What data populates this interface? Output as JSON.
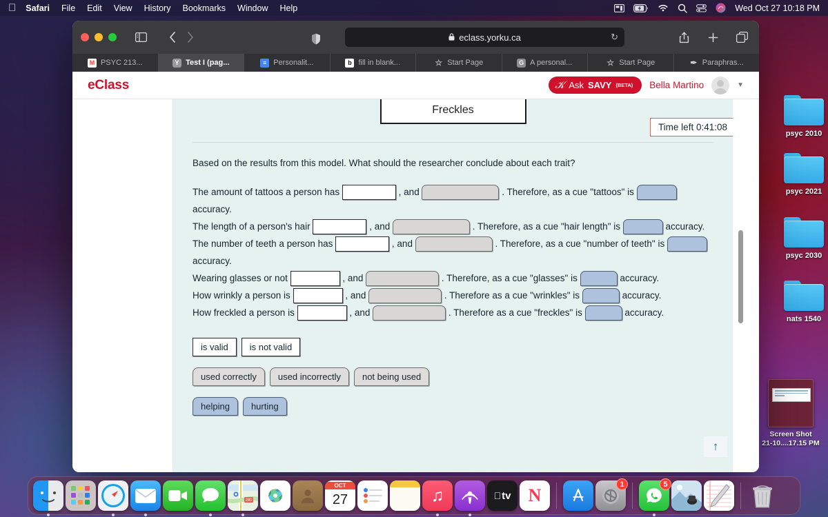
{
  "menubar": {
    "apple_icon": "apple-icon",
    "items": [
      {
        "label": "Safari",
        "bold": true
      },
      {
        "label": "File",
        "bold": false
      },
      {
        "label": "Edit",
        "bold": false
      },
      {
        "label": "View",
        "bold": false
      },
      {
        "label": "History",
        "bold": false
      },
      {
        "label": "Bookmarks",
        "bold": false
      },
      {
        "label": "Window",
        "bold": false
      },
      {
        "label": "Help",
        "bold": false
      }
    ],
    "status_icons": [
      "screen-mirroring-icon",
      "battery-charging-icon",
      "wifi-icon",
      "spotlight-search-icon",
      "control-center-icon",
      "siri-icon"
    ],
    "clock": "Wed Oct 27  10:18 PM"
  },
  "desktop": {
    "folders": [
      {
        "label": "psyc 2010"
      },
      {
        "label": "psyc 2021"
      },
      {
        "label": "psyc 2030"
      },
      {
        "label": "nats 1540"
      }
    ],
    "screenshot_file": {
      "line1": "Screen Shot",
      "line2": "21-10....17.15 PM"
    }
  },
  "safari": {
    "toolbar": {
      "sidebar_icon": "sidebar-toggle-icon",
      "back_icon": "chevron-left-icon",
      "forward_icon": "chevron-right-icon",
      "shield_icon": "privacy-shield-icon",
      "reader_icon": "reader-view-icon",
      "lock_icon": "lock-icon",
      "url": "eclass.yorku.ca",
      "reload_icon": "reload-icon",
      "share_icon": "share-icon",
      "new_tab_icon": "plus-icon",
      "tab_overview_icon": "tab-overview-icon"
    },
    "tabs": [
      {
        "label": "PSYC 213...",
        "favicon": "gmail-icon",
        "favicon_class": "gmail",
        "glyph": "M",
        "active": false
      },
      {
        "label": "Test I (pag...",
        "favicon": "yorku-icon",
        "favicon_class": "yorku",
        "glyph": "Y",
        "active": true
      },
      {
        "label": "Personalit...",
        "favicon": "google-docs-icon",
        "favicon_class": "gdocs",
        "glyph": "≡",
        "active": false
      },
      {
        "label": "fill in blank...",
        "favicon": "blackboard-icon",
        "favicon_class": "bb",
        "glyph": "b",
        "active": false
      },
      {
        "label": "Start Page",
        "favicon": "star-icon",
        "favicon_class": "star",
        "glyph": "☆",
        "active": false
      },
      {
        "label": "A personal...",
        "favicon": "google-icon",
        "favicon_class": "gsite",
        "glyph": "G",
        "active": false
      },
      {
        "label": "Start Page",
        "favicon": "star-icon",
        "favicon_class": "star",
        "glyph": "☆",
        "active": false
      },
      {
        "label": "Paraphras...",
        "favicon": "pen-icon",
        "favicon_class": "para",
        "glyph": "✒",
        "active": false
      }
    ]
  },
  "eclass": {
    "logo": "eClass",
    "savy": {
      "ask": "Ask",
      "name": "SAVY",
      "beta": "(BETA)",
      "mark_icon": "savy-logo-icon"
    },
    "user_name": "Bella Martino",
    "avatar_icon": "user-avatar-icon",
    "caret_icon": "chevron-down-icon",
    "brand_color": "#d0112b"
  },
  "quiz": {
    "diagram_label": "Freckles",
    "timer": "Time left 0:41:08",
    "prompt": "Based on the results from this model. What should the researcher conclude about each trait?",
    "rows": [
      {
        "lead": "The amount of tattoos a person has",
        "blank_white_w": 78,
        "sep": ", and",
        "blank_gray_w": 112,
        "mid": ". Therefore, as a cue \"tattoos\" is",
        "blank_blue_w": 58,
        "tail": "accuracy.",
        "wraps": true
      },
      {
        "lead": "The length of a person's hair",
        "blank_white_w": 78,
        "sep": ", and",
        "blank_gray_w": 112,
        "mid": ". Therefore, as a cue \"hair length\" is",
        "blank_blue_w": 58,
        "tail": "accuracy.",
        "wraps": true
      },
      {
        "lead": "The number of teeth a person has",
        "blank_white_w": 78,
        "sep": ", and",
        "blank_gray_w": 112,
        "mid": ". Therefore, as a cue \"number of teeth\" is",
        "blank_blue_w": 58,
        "tail": "accuracy.",
        "wraps": true
      },
      {
        "lead": "Wearing glasses or not",
        "blank_white_w": 72,
        "sep": ", and",
        "blank_gray_w": 106,
        "mid": ". Therefore, as a cue \"glasses\" is",
        "blank_blue_w": 54,
        "tail": "accuracy.",
        "wraps": false
      },
      {
        "lead": "How wrinkly a person is",
        "blank_white_w": 72,
        "sep": ", and",
        "blank_gray_w": 106,
        "mid": ". Therefore as a cue \"wrinkles\" is",
        "blank_blue_w": 54,
        "tail": "accuracy.",
        "wraps": false
      },
      {
        "lead": "How freckled a person is",
        "blank_white_w": 72,
        "sep": ", and",
        "blank_gray_w": 106,
        "mid": ". Therefore as a cue \"freckles\" is",
        "blank_blue_w": 54,
        "tail": "accuracy.",
        "wraps": false
      }
    ],
    "token_groups": [
      {
        "style": "valid",
        "tokens": [
          "is valid",
          "is not valid"
        ]
      },
      {
        "style": "gray",
        "tokens": [
          "used correctly",
          "used incorrectly",
          "not being used"
        ]
      },
      {
        "style": "blue",
        "tokens": [
          "helping",
          "hurting"
        ]
      }
    ],
    "to_top_icon": "scroll-to-top-arrow-icon"
  },
  "dock": {
    "apps": [
      {
        "name": "finder",
        "glyph": "",
        "running": true
      },
      {
        "name": "launchpad",
        "glyph": "",
        "running": false
      },
      {
        "name": "safari",
        "glyph": "",
        "running": true
      },
      {
        "name": "mail",
        "glyph": "✉",
        "running": true
      },
      {
        "name": "facetime",
        "glyph": "",
        "running": false
      },
      {
        "name": "messages",
        "glyph": "",
        "running": true
      },
      {
        "name": "maps",
        "glyph": "",
        "running": true
      },
      {
        "name": "photos",
        "glyph": "",
        "running": false
      },
      {
        "name": "contacts",
        "glyph": "",
        "running": false
      },
      {
        "name": "calendar",
        "glyph": "27",
        "running": false,
        "month": "OCT"
      },
      {
        "name": "reminders",
        "glyph": "",
        "running": false
      },
      {
        "name": "notes",
        "glyph": "",
        "running": false
      },
      {
        "name": "music",
        "glyph": "♫",
        "running": true
      },
      {
        "name": "podcasts",
        "glyph": "",
        "running": true
      },
      {
        "name": "apple-tv",
        "glyph": "tv",
        "running": false
      },
      {
        "name": "news",
        "glyph": "N",
        "running": false
      },
      {
        "name": "app-store",
        "glyph": "A",
        "running": false
      },
      {
        "name": "system-preferences",
        "glyph": "",
        "running": false,
        "badge": "1"
      },
      {
        "name": "whatsapp",
        "glyph": "",
        "running": true,
        "badge": "5"
      },
      {
        "name": "preview",
        "glyph": "",
        "running": false
      },
      {
        "name": "textedit",
        "glyph": "",
        "running": false
      },
      {
        "name": "trash",
        "glyph": "",
        "running": false
      }
    ]
  }
}
